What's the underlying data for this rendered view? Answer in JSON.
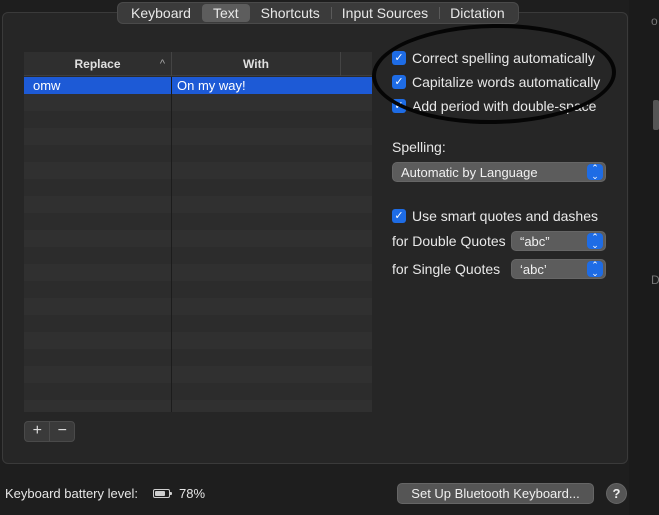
{
  "tabs": [
    {
      "label": "Keyboard",
      "active": false
    },
    {
      "label": "Text",
      "active": true
    },
    {
      "label": "Shortcuts",
      "active": false
    },
    {
      "label": "Input Sources",
      "active": false
    },
    {
      "label": "Dictation",
      "active": false
    }
  ],
  "table": {
    "columns": [
      "Replace",
      "With"
    ],
    "rows": [
      {
        "replace": "omw",
        "with": "On my way!",
        "selected": true
      }
    ]
  },
  "options": {
    "correct_spelling": "Correct spelling automatically",
    "capitalize_words": "Capitalize words automatically",
    "add_period": "Add period with double-space",
    "spelling_label": "Spelling:",
    "spelling_value": "Automatic by Language",
    "smart_quotes": "Use smart quotes and dashes",
    "double_quotes_label": "for Double Quotes",
    "double_quotes_value": "“abc”",
    "single_quotes_label": "for Single Quotes",
    "single_quotes_value": "‘abc’"
  },
  "buttons": {
    "add": "+",
    "remove": "−",
    "bluetooth": "Set Up Bluetooth Keyboard...",
    "help": "?"
  },
  "footer": {
    "battery_label": "Keyboard battery level:",
    "battery_percent": "78%"
  },
  "colors": {
    "accent": "#1e6ce5",
    "selection": "#1d5ad6",
    "annotation": "#050505"
  }
}
